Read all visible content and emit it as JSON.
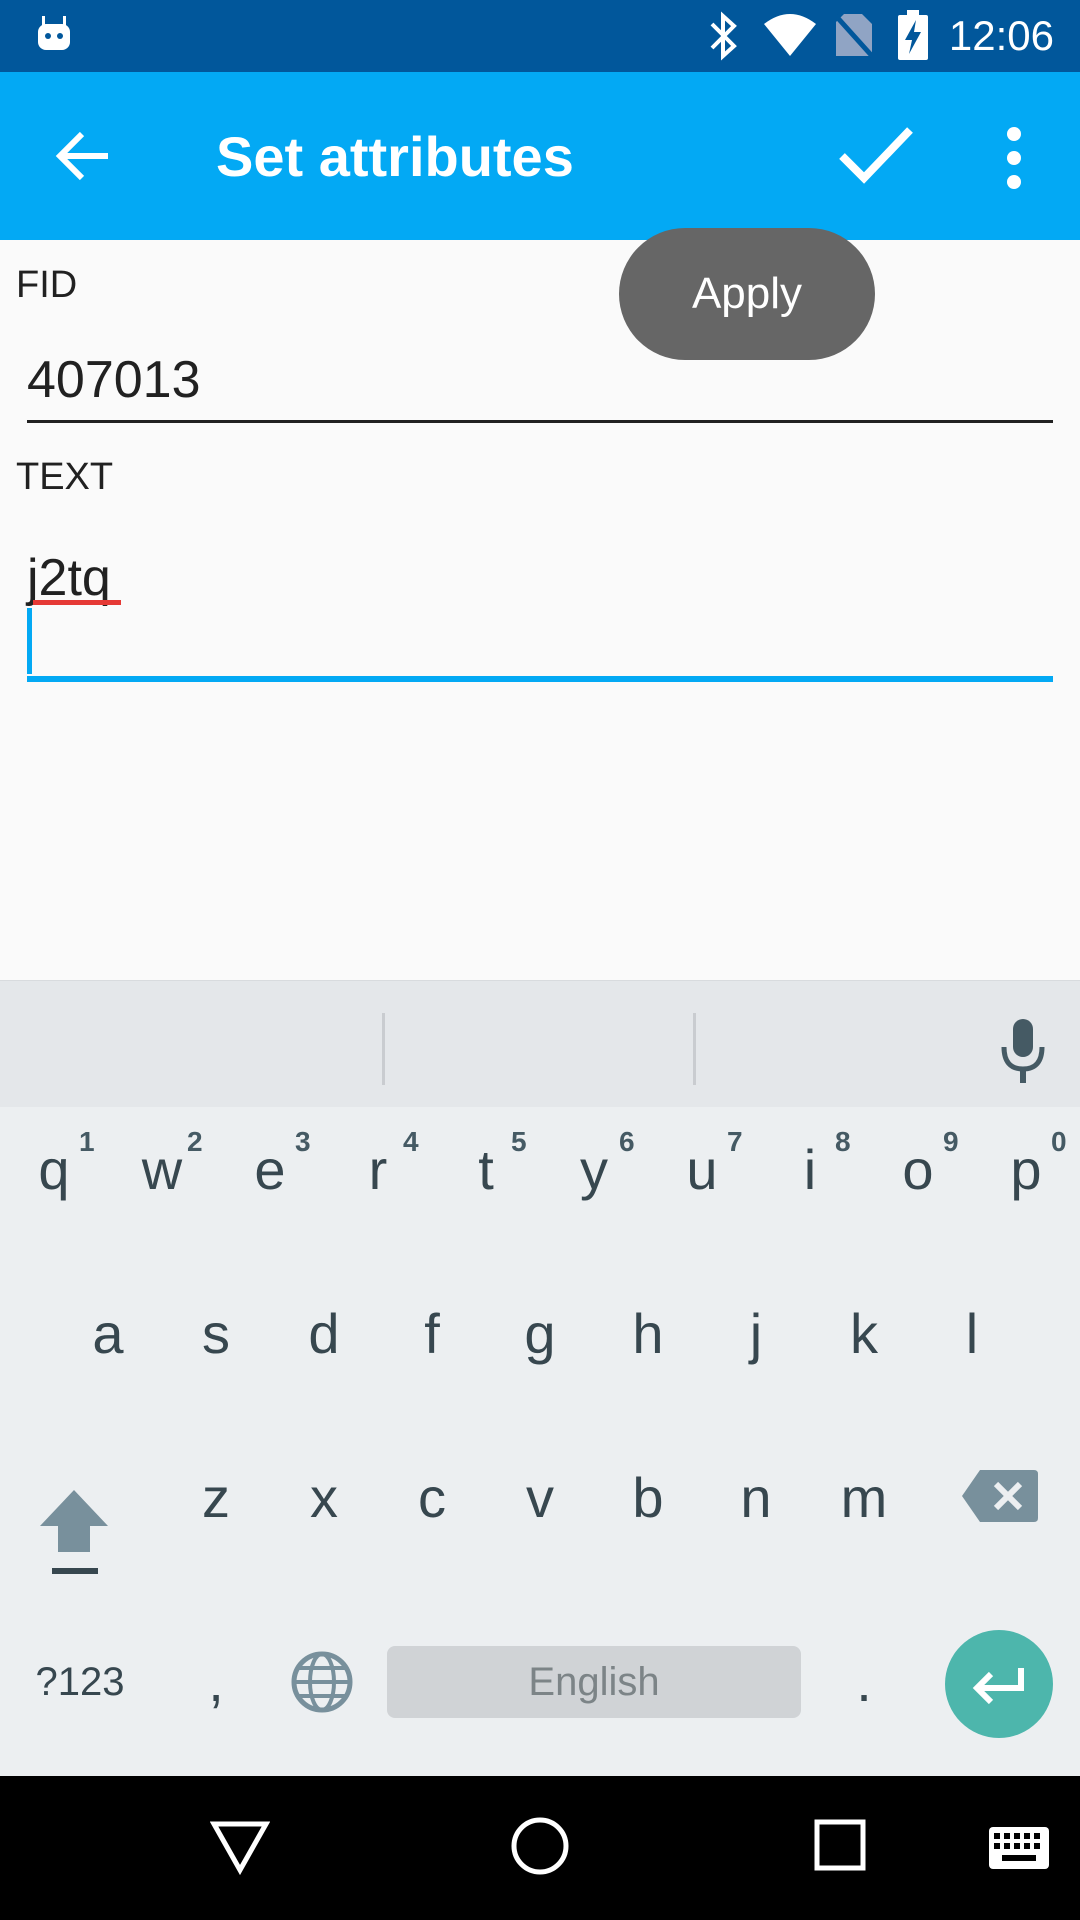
{
  "status_bar": {
    "time": "12:06",
    "icons": [
      "android-icon",
      "bluetooth-icon",
      "wifi-icon",
      "no-sim-icon",
      "battery-charging-icon"
    ]
  },
  "app_bar": {
    "title": "Set attributes",
    "back_icon": "arrow-back-icon",
    "confirm_icon": "check-icon",
    "menu_icon": "more-vert-icon",
    "color": "#03a9f4"
  },
  "toast": {
    "text": "Apply"
  },
  "form": {
    "fid_label": "FID",
    "fid_value": "407013",
    "text_label": "TEXT",
    "text_value": "j2tq",
    "focus_color": "#03a9f4"
  },
  "keyboard": {
    "row1": [
      "q",
      "w",
      "e",
      "r",
      "t",
      "y",
      "u",
      "i",
      "o",
      "p"
    ],
    "row1_hints": [
      "1",
      "2",
      "3",
      "4",
      "5",
      "6",
      "7",
      "8",
      "9",
      "0"
    ],
    "row2": [
      "a",
      "s",
      "d",
      "f",
      "g",
      "h",
      "j",
      "k",
      "l"
    ],
    "row3": [
      "z",
      "x",
      "c",
      "v",
      "b",
      "n",
      "m"
    ],
    "symbols_key": "?123",
    "comma_key": ",",
    "period_key": ".",
    "space_label": "English",
    "enter_color": "#4db6ac"
  },
  "nav_bar": {
    "icons": [
      "back-triangle-icon",
      "home-circle-icon",
      "recents-square-icon",
      "keyboard-icon"
    ]
  }
}
